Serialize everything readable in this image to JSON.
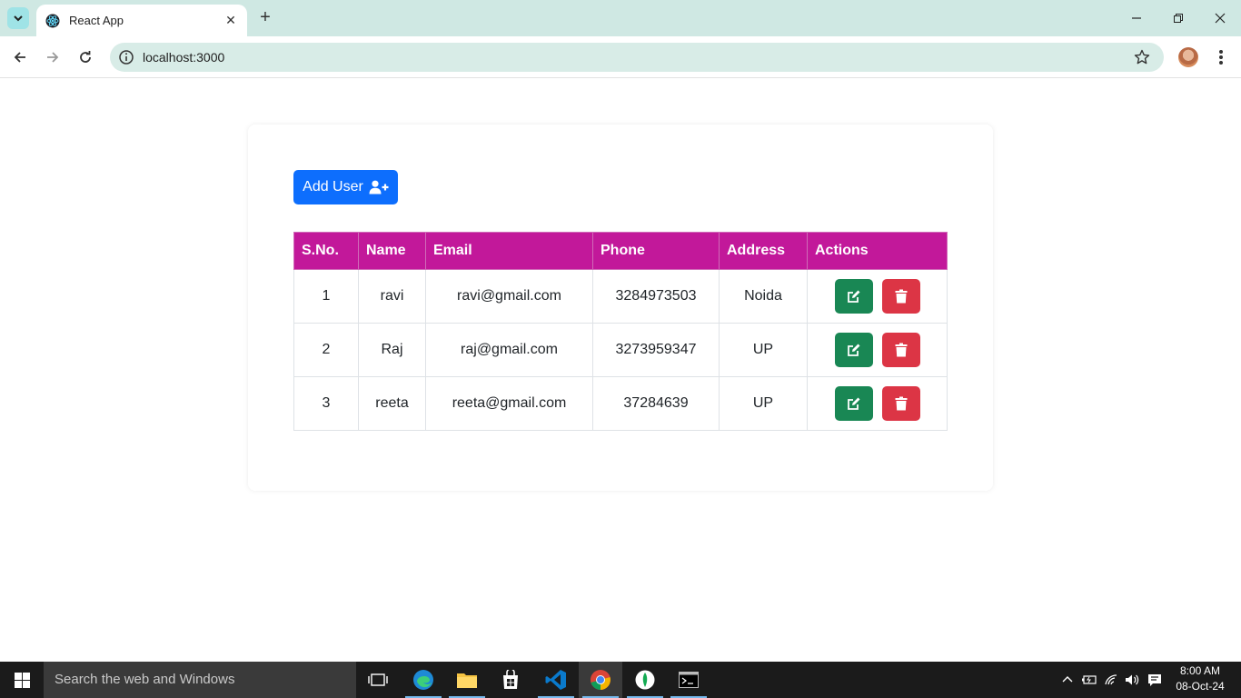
{
  "browser": {
    "tab_title": "React App",
    "url": "localhost:3000"
  },
  "app": {
    "add_button_label": "Add User",
    "table": {
      "headers": [
        "S.No.",
        "Name",
        "Email",
        "Phone",
        "Address",
        "Actions"
      ],
      "rows": [
        {
          "sno": "1",
          "name": "ravi",
          "email": "ravi@gmail.com",
          "phone": "3284973503",
          "address": "Noida"
        },
        {
          "sno": "2",
          "name": "Raj",
          "email": "raj@gmail.com",
          "phone": "3273959347",
          "address": "UP"
        },
        {
          "sno": "3",
          "name": "reeta",
          "email": "reeta@gmail.com",
          "phone": "37284639",
          "address": "UP"
        }
      ]
    }
  },
  "taskbar": {
    "search_placeholder": "Search the web and Windows",
    "time": "8:00 AM",
    "date": "08-Oct-24"
  },
  "colors": {
    "header_bg": "#c2189a",
    "add_button": "#0d6efd",
    "edit_button": "#198754",
    "delete_button": "#dc3545"
  }
}
